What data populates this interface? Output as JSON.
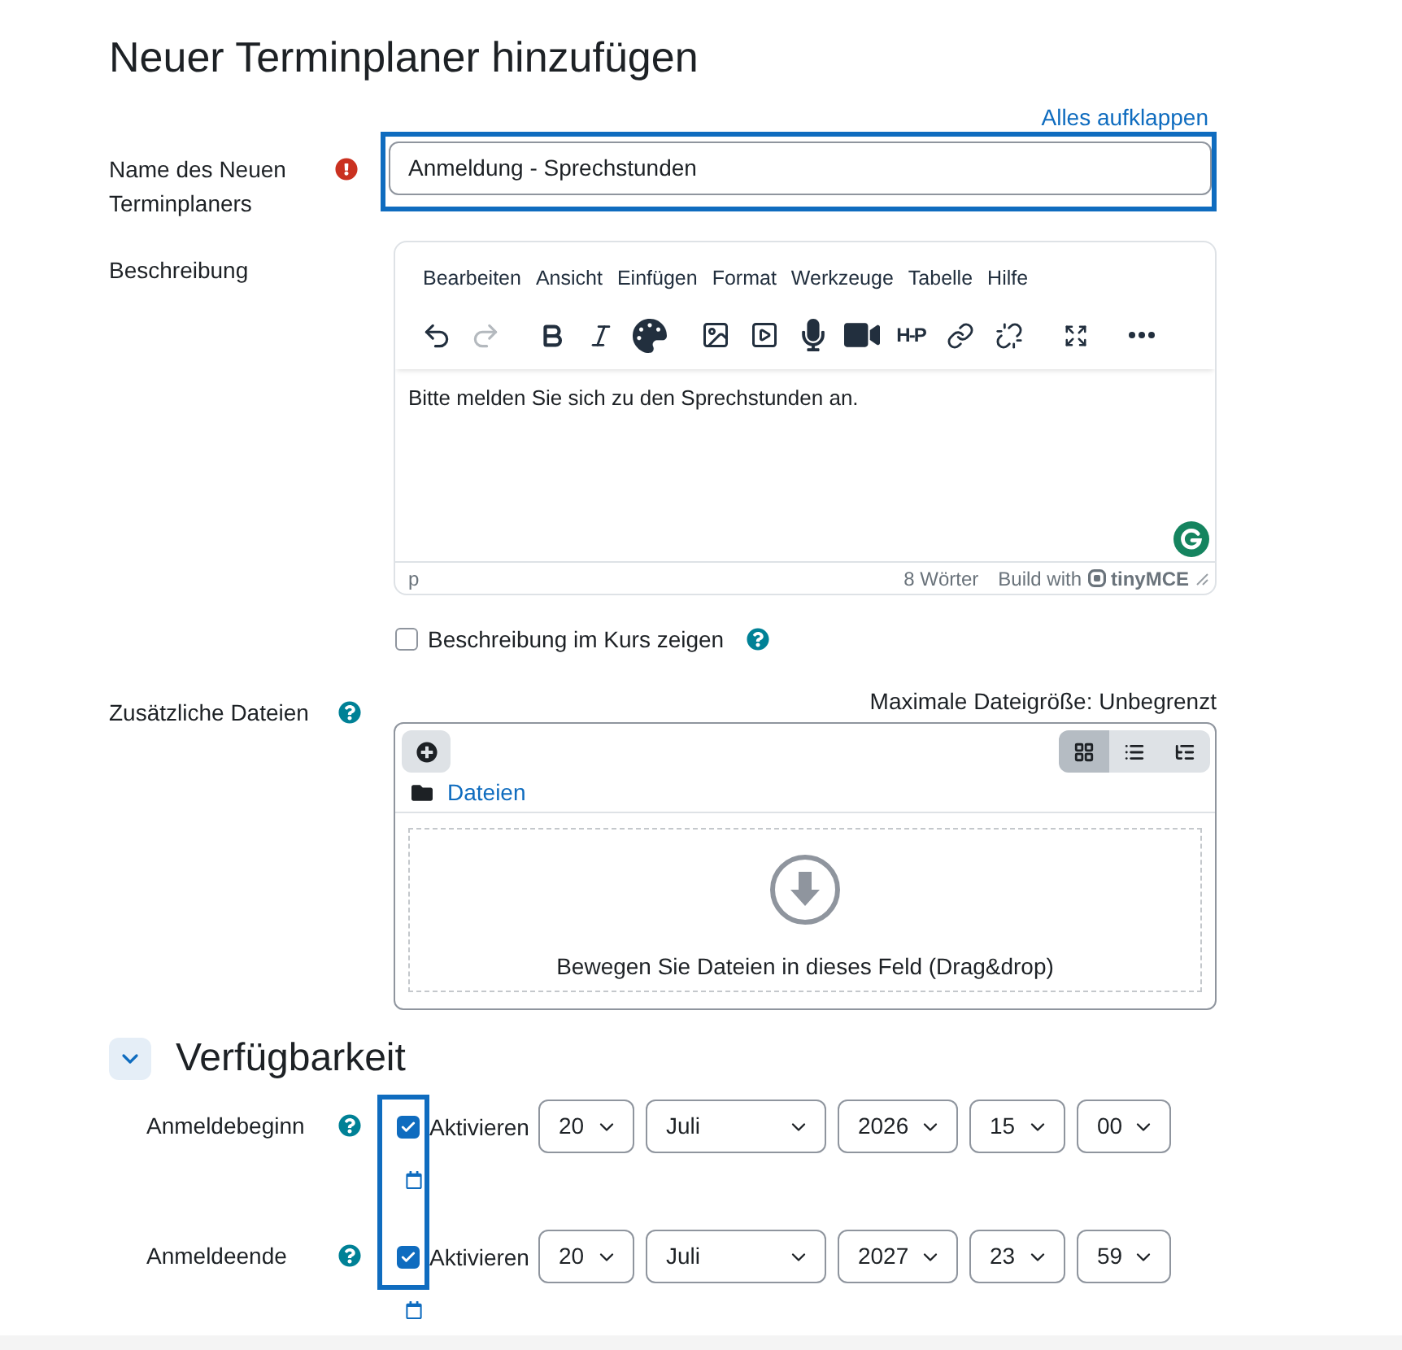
{
  "title": "Neuer Terminplaner hinzufügen",
  "expand_all": "Alles aufklappen",
  "name_field": {
    "label": "Name des Neuen Terminplaners",
    "required": true,
    "value": "Anmeldung - Sprechstunden",
    "highlighted": true
  },
  "description": {
    "label": "Beschreibung",
    "menu": [
      "Bearbeiten",
      "Ansicht",
      "Einfügen",
      "Format",
      "Werkzeuge",
      "Tabelle",
      "Hilfe"
    ],
    "toolbar_groups": [
      {
        "items": [
          {
            "kind": "undo",
            "disabled": false
          },
          {
            "kind": "redo",
            "disabled": true
          }
        ]
      },
      {
        "items": [
          {
            "kind": "bold",
            "disabled": false
          },
          {
            "kind": "italic",
            "disabled": false
          },
          {
            "kind": "palette",
            "disabled": false
          }
        ]
      },
      {
        "items": [
          {
            "kind": "image",
            "disabled": false
          },
          {
            "kind": "media",
            "disabled": false
          },
          {
            "kind": "microphone",
            "disabled": false
          },
          {
            "kind": "video",
            "disabled": false
          },
          {
            "kind": "h5p",
            "label": "H-P",
            "disabled": false
          },
          {
            "kind": "link",
            "disabled": false
          },
          {
            "kind": "unlink",
            "disabled": false
          }
        ]
      },
      {
        "items": [
          {
            "kind": "fullscreen",
            "disabled": false
          }
        ]
      },
      {
        "items": [
          {
            "kind": "more",
            "disabled": false
          }
        ]
      }
    ],
    "content": "Bitte melden Sie sich zu den Sprechstunden an.",
    "path": "p",
    "word_count": "8 Wörter",
    "credit": "Build with",
    "brand": "tinyMCE"
  },
  "show_in_course": {
    "label": "Beschreibung im Kurs zeigen",
    "checked": false
  },
  "files": {
    "label": "Zusätzliche Dateien",
    "max_size": "Maximale Dateigröße: Unbegrenzt",
    "views": [
      {
        "kind": "grid",
        "selected": true
      },
      {
        "kind": "list",
        "selected": false
      },
      {
        "kind": "tree",
        "selected": false
      }
    ],
    "folder": "Dateien",
    "drop_hint": "Bewegen Sie Dateien in dieses Feld (Drag&drop)"
  },
  "availability": {
    "title": "Verfügbarkeit",
    "expanded": true,
    "checkbox_highlight": true,
    "dates": [
      {
        "label": "Anmeldebeginn",
        "checked": true,
        "option": "Aktivieren",
        "fields": [
          "20",
          "Juli",
          "2026",
          "15",
          "00"
        ]
      },
      {
        "label": "Anmeldeende",
        "checked": true,
        "option": "Aktivieren",
        "fields": [
          "20",
          "Juli",
          "2027",
          "23",
          "59"
        ]
      }
    ]
  }
}
